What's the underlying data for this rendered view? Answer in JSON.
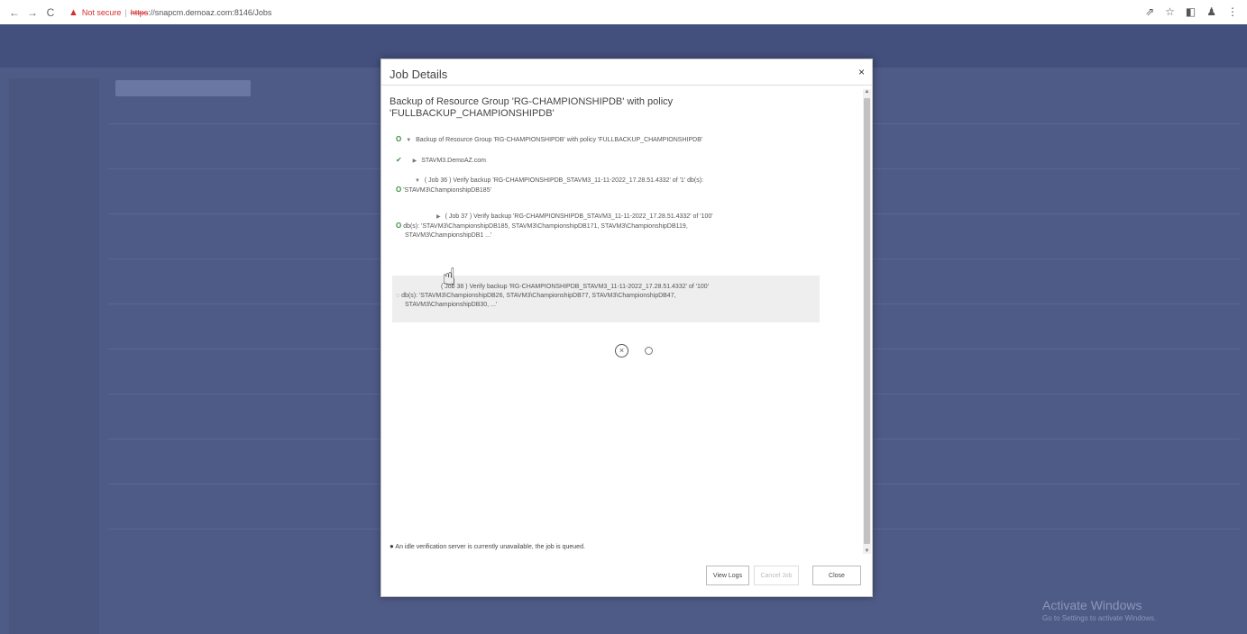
{
  "browser": {
    "back": "←",
    "forward": "→",
    "reload": "C",
    "warning_icon": "▲",
    "not_secure": "Not secure",
    "sep": "|",
    "url_scheme": "https",
    "url_rest": "://snapcm.demoaz.com:8146/Jobs",
    "right_icons": [
      "⇗",
      "☆",
      "◧",
      "♟",
      "⋮"
    ]
  },
  "dialog": {
    "title": "Job Details",
    "close": "×",
    "heading": "Backup of Resource Group 'RG-CHAMPIONSHIPDB' with policy 'FULLBACKUP_CHAMPIONSHIPDB'",
    "tree": [
      {
        "status": "O",
        "text": "Backup of Resource Group 'RG-CHAMPIONSHIPDB' with policy 'FULLBACKUP_CHAMPIONSHIPDB'"
      },
      {
        "status": "✔",
        "text": "STAVM3.DemoAZ.com"
      },
      {
        "status": "O",
        "text_line1": "( Job 36 ) Verify backup 'RG-CHAMPIONSHIPDB_STAVM3_11-11-2022_17.28.51.4332' of '1' db(s):",
        "text_line2": "'STAVM3\\ChampionshipDB185'"
      },
      {
        "status": "O",
        "text_line1": "( Job 37 ) Verify backup 'RG-CHAMPIONSHIPDB_STAVM3_11-11-2022_17.28.51.4332' of '100'",
        "text_line2": "db(s): 'STAVM3\\ChampionshipDB185, STAVM3\\ChampionshipDB171, STAVM3\\ChampionshipDB119,",
        "text_line3": "STAVM3\\ChampionshipDB1 ...'"
      },
      {
        "status": "◌",
        "text_line1": "( Job 38 ) Verify backup 'RG-CHAMPIONSHIPDB_STAVM3_11-11-2022_17.28.51.4332' of '100'",
        "text_line2": "db(s): 'STAVM3\\ChampionshipDB26, STAVM3\\ChampionshipDB77, STAVM3\\ChampionshipDB47,",
        "text_line3": "STAVM3\\ChampionshipDB30, ...'"
      }
    ],
    "stop_icon": "×",
    "footer_message": "An idle verification server is currently unavailable, the job is queued.",
    "info_icon": "●",
    "buttons": {
      "view_logs": "View Logs",
      "cancel_job": "Cancel Job",
      "close": "Close"
    }
  },
  "watermark": {
    "title": "Activate Windows",
    "subtitle": "Go to Settings to activate Windows."
  },
  "cursor": "☝"
}
